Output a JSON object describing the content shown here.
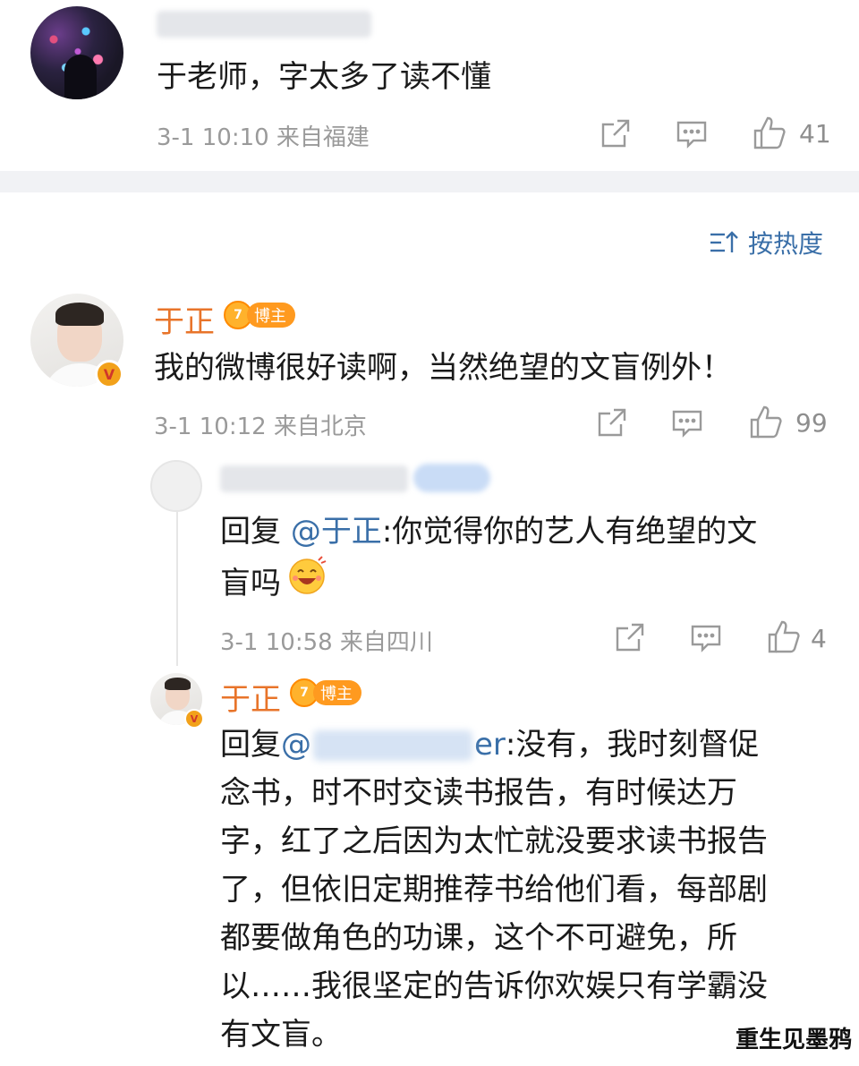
{
  "comment_top": {
    "text": "于老师，字太多了读不懂",
    "meta": "3-1 10:10  来自福建",
    "likes": "41"
  },
  "sort": {
    "label": "按热度"
  },
  "comment_main": {
    "name": "于正",
    "badge": "博主",
    "text": "我的微博很好读啊，当然绝望的文盲例外！",
    "meta": "3-1 10:12  来自北京",
    "likes": "99"
  },
  "reply_1": {
    "prefix": "回复 ",
    "mention": "@于正",
    "text_l1": ":你觉得你的艺人有绝望的文",
    "text_l2": "盲吗",
    "meta": "3-1 10:58  来自四川",
    "likes": "4"
  },
  "reply_2": {
    "name": "于正",
    "badge": "博主",
    "prefix": "回复 ",
    "mention_start": "@",
    "mention_end": "er",
    "lines": [
      ":没有，我时刻督促",
      "念书，时不时交读书报告，有时候达万",
      "字，红了之后因为太忙就没要求读书报告",
      "了，但依旧定期推荐书给他们看，每部剧",
      "都要做角色的功课，这个不可避免，所",
      "以……我很坚定的告诉你欢娱只有学霸没",
      "有文盲。"
    ]
  },
  "watermark": {
    "text": "重生见墨鸦"
  },
  "colors": {
    "accent": "#e8742a",
    "link": "#3a6fa8",
    "meta": "#9a9a9a"
  },
  "icons": [
    "share-icon",
    "comment-icon",
    "like-icon",
    "sort-icon",
    "verified-icon",
    "crown-icon"
  ]
}
